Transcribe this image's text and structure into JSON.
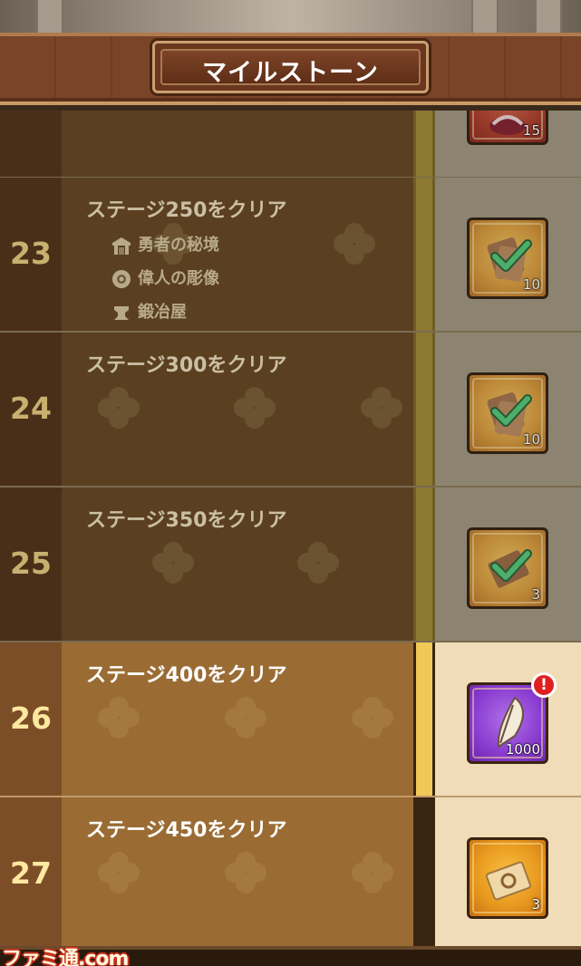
{
  "header": {
    "title": "マイルストーン"
  },
  "rows": [
    {
      "number": "",
      "task": "",
      "reward": {
        "icon": "red-item-icon",
        "qty": "15"
      },
      "state": "done"
    },
    {
      "number": "23",
      "task": "ステージ250をクリア",
      "unlocks": [
        {
          "icon": "shrine-icon",
          "label": "勇者の秘境"
        },
        {
          "icon": "gear-statue-icon",
          "label": "偉人の彫像"
        },
        {
          "icon": "anvil-icon",
          "label": "鍛冶屋"
        }
      ],
      "reward": {
        "icon": "scroll-icon",
        "qty": "10",
        "claimed": true
      },
      "state": "done"
    },
    {
      "number": "24",
      "task": "ステージ300をクリア",
      "unlocks": [],
      "reward": {
        "icon": "scroll-icon",
        "qty": "10",
        "claimed": true
      },
      "state": "done"
    },
    {
      "number": "25",
      "task": "ステージ350をクリア",
      "unlocks": [],
      "reward": {
        "icon": "ticket-icon",
        "qty": "3",
        "claimed": true
      },
      "state": "done"
    },
    {
      "number": "26",
      "task": "ステージ400をクリア",
      "unlocks": [],
      "reward": {
        "icon": "feather-icon",
        "qty": "1000",
        "claimed": false,
        "alert": "!"
      },
      "state": "active"
    },
    {
      "number": "27",
      "task": "ステージ450をクリア",
      "unlocks": [],
      "reward": {
        "icon": "summon-ticket-icon",
        "qty": "3",
        "claimed": false
      },
      "state": "locked"
    }
  ],
  "watermark": "ファミ通.com",
  "colors": {
    "accent_gold": "#f0c858",
    "done_bg": "#5a4020",
    "active_bg": "#9a6c34",
    "check_green": "#3ccf6a"
  }
}
